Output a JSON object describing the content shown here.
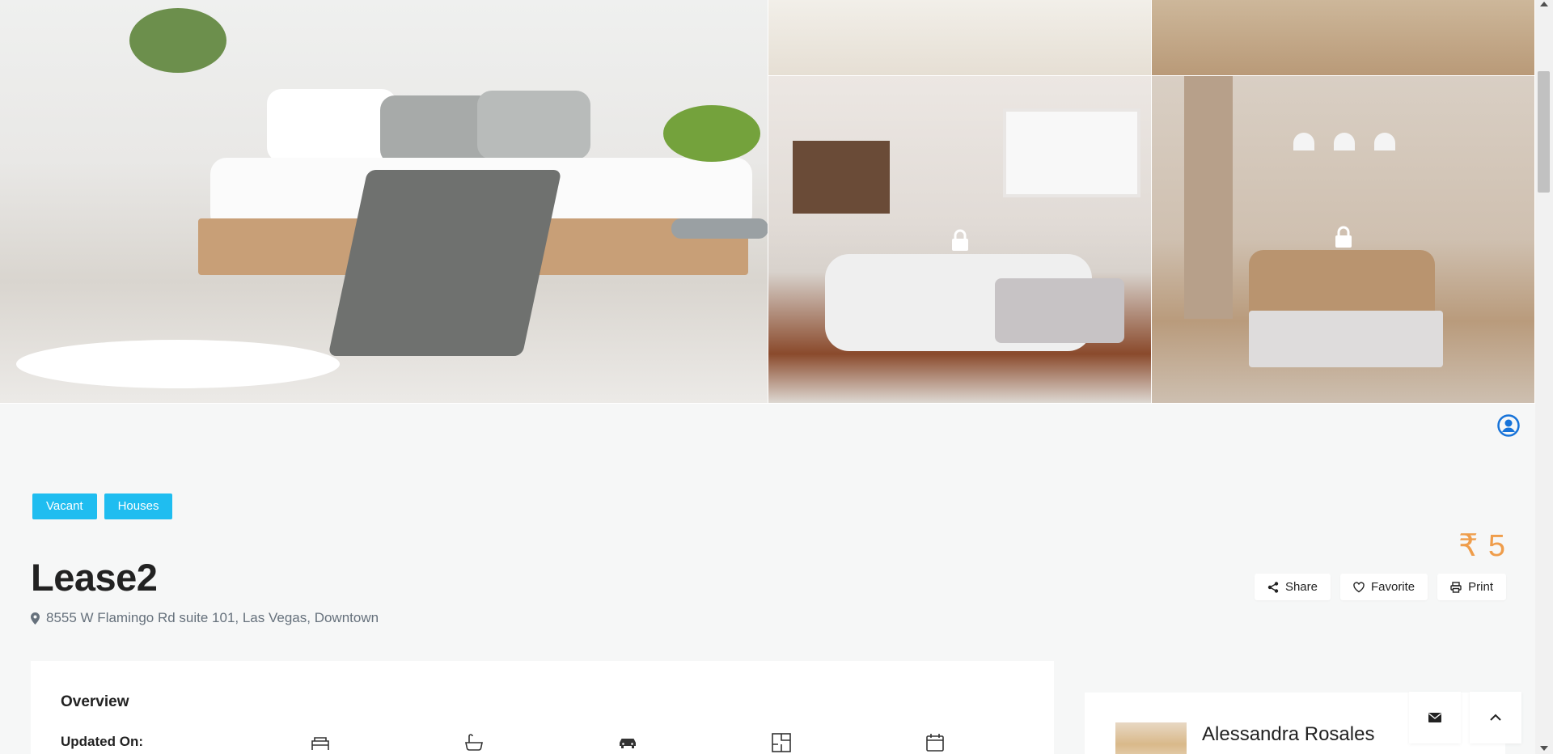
{
  "gallery": {
    "images": [
      "bedroom-photo",
      "dining-photo",
      "dining-table-photo",
      "living-room-photo",
      "lounge-photo"
    ]
  },
  "tags": [
    "Vacant",
    "Houses"
  ],
  "property": {
    "title": "Lease2",
    "address": "8555 W Flamingo Rd suite 101, Las Vegas, Downtown",
    "price": "₹ 5"
  },
  "actions": {
    "share": "Share",
    "favorite": "Favorite",
    "print": "Print"
  },
  "overview": {
    "title": "Overview",
    "updated_label": "Updated On:",
    "icons": [
      "bed-icon",
      "bath-icon",
      "car-icon",
      "floor-plan-icon",
      "calendar-icon"
    ]
  },
  "agent": {
    "name": "Alessandra Rosales"
  },
  "colors": {
    "accent": "#1fbdf0",
    "price": "#ef9d4b",
    "user_icon": "#1773d9"
  }
}
